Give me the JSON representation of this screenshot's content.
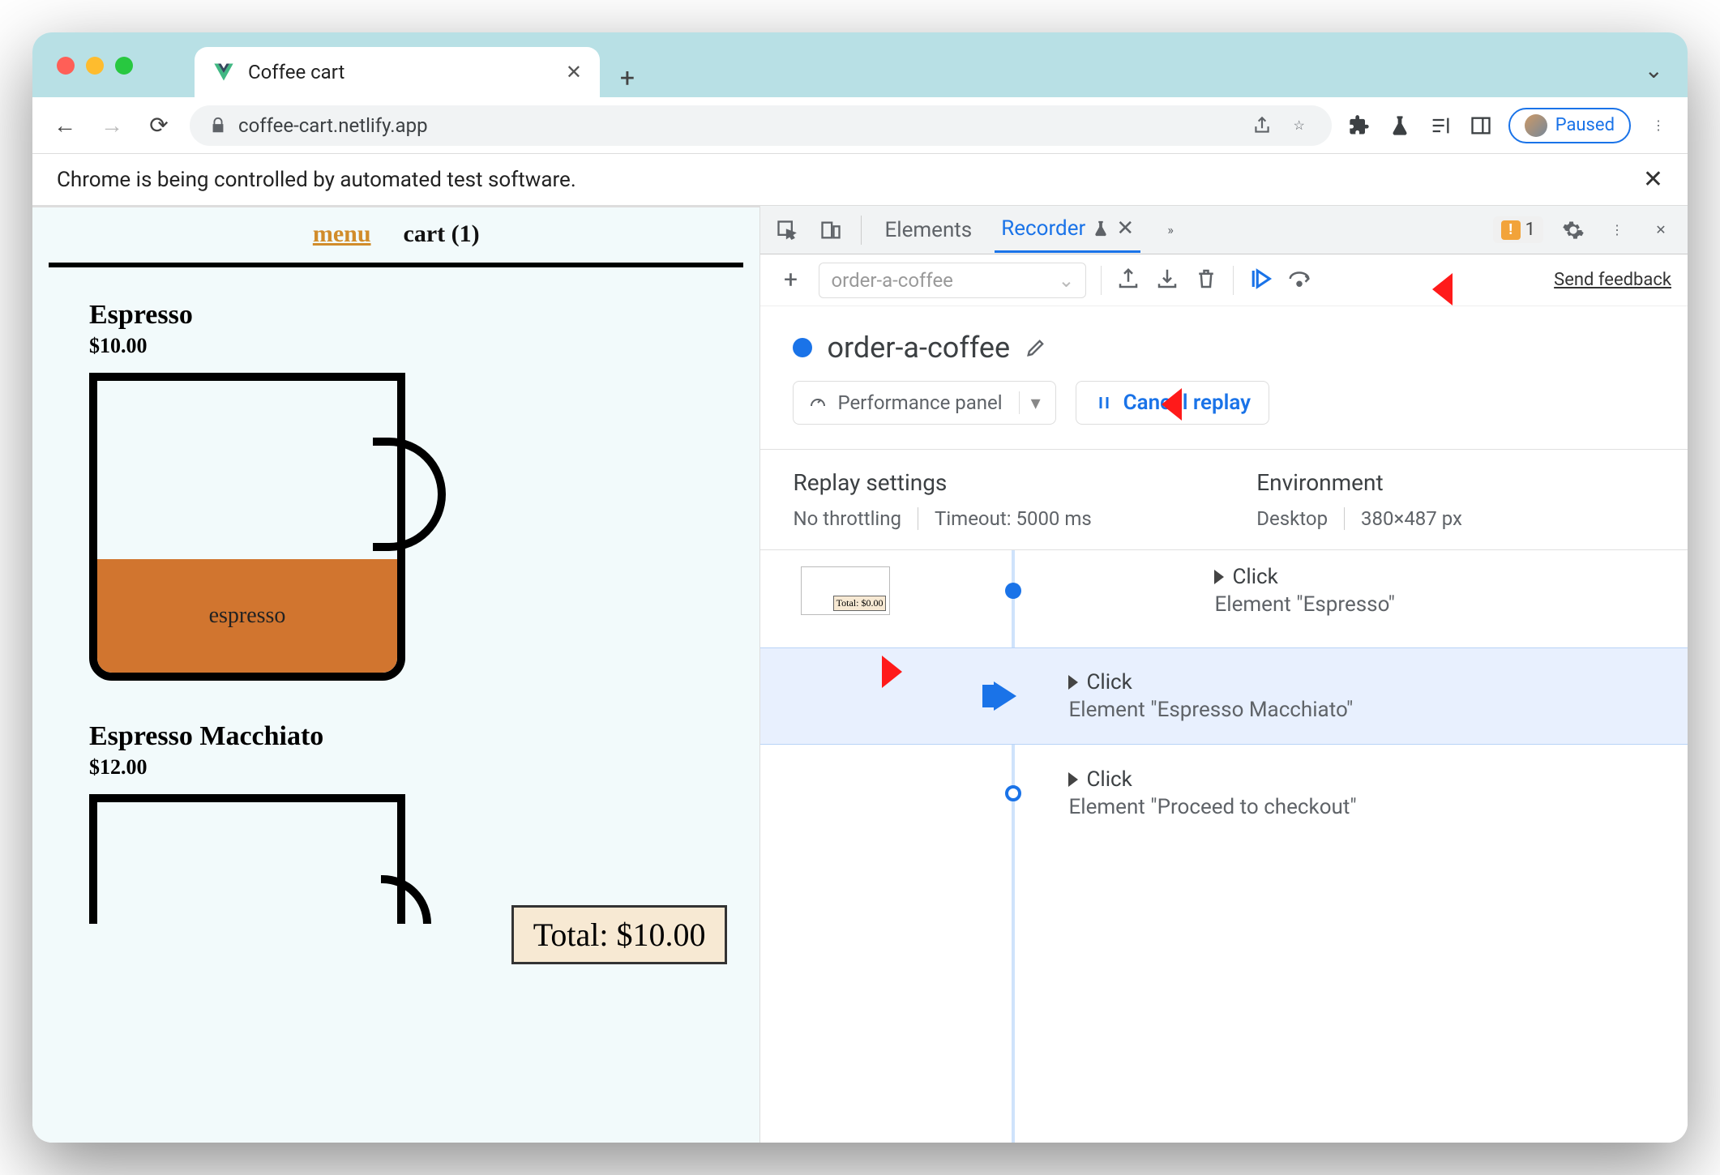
{
  "browser": {
    "tab_title": "Coffee cart",
    "url": "coffee-cart.netlify.app",
    "paused_label": "Paused",
    "banner_text": "Chrome is being controlled by automated test software."
  },
  "page": {
    "nav": {
      "menu": "menu",
      "cart": "cart (1)"
    },
    "products": [
      {
        "name": "Espresso",
        "price": "$10.00",
        "fill_label": "espresso"
      },
      {
        "name": "Espresso Macchiato",
        "price": "$12.00"
      }
    ],
    "total_label": "Total: $10.00"
  },
  "devtools": {
    "tabs": {
      "elements": "Elements",
      "recorder": "Recorder"
    },
    "issues_count": "1",
    "send_feedback": "Send feedback",
    "recording_input_placeholder": "order-a-coffee",
    "recording_name": "order-a-coffee",
    "perf_panel_label": "Performance panel",
    "cancel_replay_label": "Cancel replay",
    "settings": {
      "replay_title": "Replay settings",
      "throttling": "No throttling",
      "timeout": "Timeout: 5000 ms",
      "env_title": "Environment",
      "env_device": "Desktop",
      "env_size": "380×487 px"
    },
    "steps": [
      {
        "action": "Click",
        "target": "Element \"Espresso\"",
        "thumb_total": "Total: $0.00"
      },
      {
        "action": "Click",
        "target": "Element \"Espresso Macchiato\""
      },
      {
        "action": "Click",
        "target": "Element \"Proceed to checkout\""
      }
    ]
  }
}
